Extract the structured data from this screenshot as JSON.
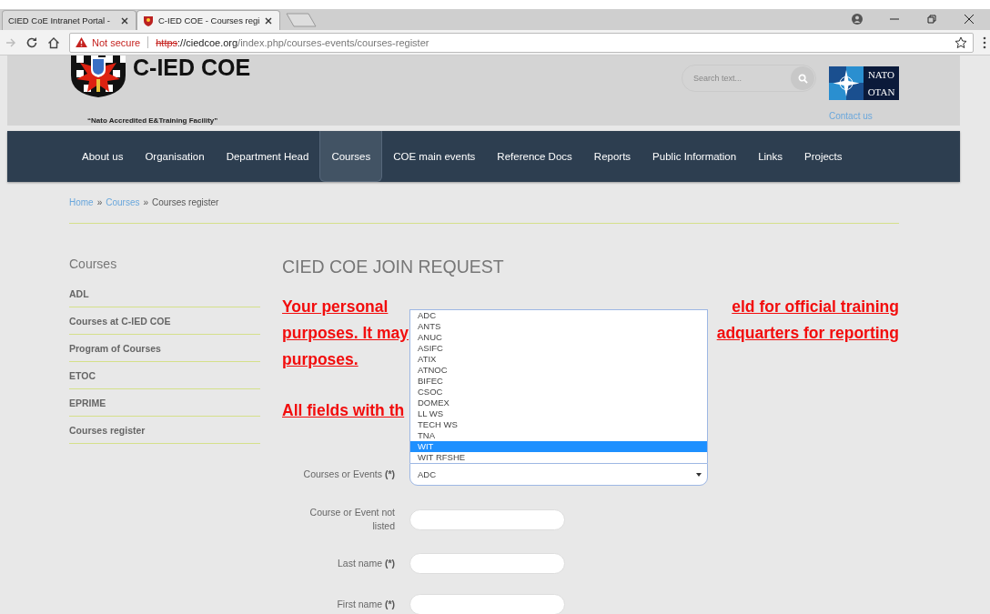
{
  "browser": {
    "tabs": [
      {
        "title": "CIED CoE Intranet Portal -",
        "selected": false
      },
      {
        "title": "C-IED COE - Courses regi",
        "selected": true
      }
    ],
    "address": {
      "security": "Not secure",
      "scheme": "https",
      "domain": "://ciedcoe.org",
      "path": "/index.php/courses-events/courses-register"
    }
  },
  "header": {
    "site_name": "C-IED COE",
    "tagline": "“Nato Accredited E&Training  Facility”",
    "search": {
      "placeholder": "Search text..."
    },
    "nato_logo": [
      "NATO",
      "OTAN"
    ],
    "contact_link": "Contact us"
  },
  "nav": [
    {
      "label": "About us",
      "selected": false
    },
    {
      "label": "Organisation",
      "selected": false
    },
    {
      "label": "Department Head",
      "selected": false
    },
    {
      "label": "Courses",
      "selected": true
    },
    {
      "label": "COE main events",
      "selected": false
    },
    {
      "label": "Reference Docs",
      "selected": false
    },
    {
      "label": "Reports",
      "selected": false
    },
    {
      "label": "Public Information",
      "selected": false
    },
    {
      "label": "Links",
      "selected": false
    },
    {
      "label": "Projects",
      "selected": false
    }
  ],
  "breadcrumb": {
    "links": [
      "Home",
      "Courses"
    ],
    "separator": "»",
    "current": "Courses register"
  },
  "sidebar": {
    "title": "Courses",
    "items": [
      "ADL",
      "Courses at C-IED COE",
      "Program of Courses",
      "ETOC",
      "EPRIME",
      "Courses register"
    ]
  },
  "main": {
    "title": "CIED COE JOIN REQUEST",
    "notice_lines": [
      {
        "left": "Your personal",
        "right": "eld for official training"
      },
      {
        "left": "purposes. It may",
        "right": "adquarters for reporting"
      },
      {
        "left": "purposes."
      }
    ],
    "required_note": "All fields with th",
    "form": [
      {
        "kind": "select",
        "label": "Courses or Events",
        "required": true,
        "value": "ADC",
        "options": [
          {
            "label": "ADC",
            "highlighted": false
          },
          {
            "label": "ANTS",
            "highlighted": false
          },
          {
            "label": "ANUC",
            "highlighted": false
          },
          {
            "label": "ASIFC",
            "highlighted": false
          },
          {
            "label": "ATIX",
            "highlighted": false
          },
          {
            "label": "ATNOC",
            "highlighted": false
          },
          {
            "label": "BIFEC",
            "highlighted": false
          },
          {
            "label": "CSOC",
            "highlighted": false
          },
          {
            "label": "DOMEX",
            "highlighted": false
          },
          {
            "label": "LL WS",
            "highlighted": false
          },
          {
            "label": "TECH WS",
            "highlighted": false
          },
          {
            "label": "TNA",
            "highlighted": false
          },
          {
            "label": "WIT",
            "highlighted": true
          },
          {
            "label": "WIT RFSHE",
            "highlighted": false
          }
        ]
      },
      {
        "kind": "text",
        "label": "Course or Event not listed",
        "required": false
      },
      {
        "kind": "text",
        "label": "Last name",
        "required": true
      },
      {
        "kind": "text",
        "label": "First name",
        "required": true
      }
    ],
    "required_mark": "(*)"
  }
}
